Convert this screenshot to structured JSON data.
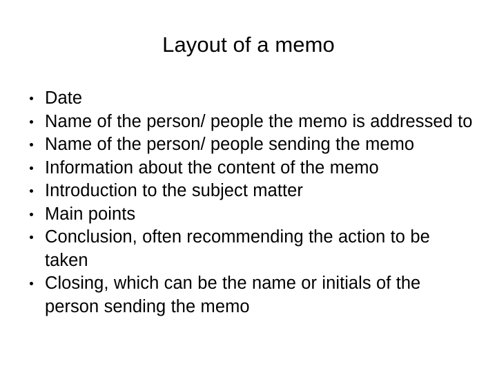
{
  "slide": {
    "title": "Layout of a memo",
    "bullet_marker": "filled-round-bullet",
    "text_color": "#000000",
    "background_color": "#ffffff",
    "bullets": [
      {
        "text": "Date"
      },
      {
        "text": "Name of the person/ people the memo is addressed to"
      },
      {
        "text": "Name of the person/ people sending the memo"
      },
      {
        "text": "Information about the content of the memo"
      },
      {
        "text": "Introduction to the subject matter"
      },
      {
        "text": "Main points"
      },
      {
        "text": "Conclusion, often recommending the action to be taken"
      },
      {
        "text": "Closing, which can be the name or initials of the person sending the memo"
      }
    ]
  }
}
